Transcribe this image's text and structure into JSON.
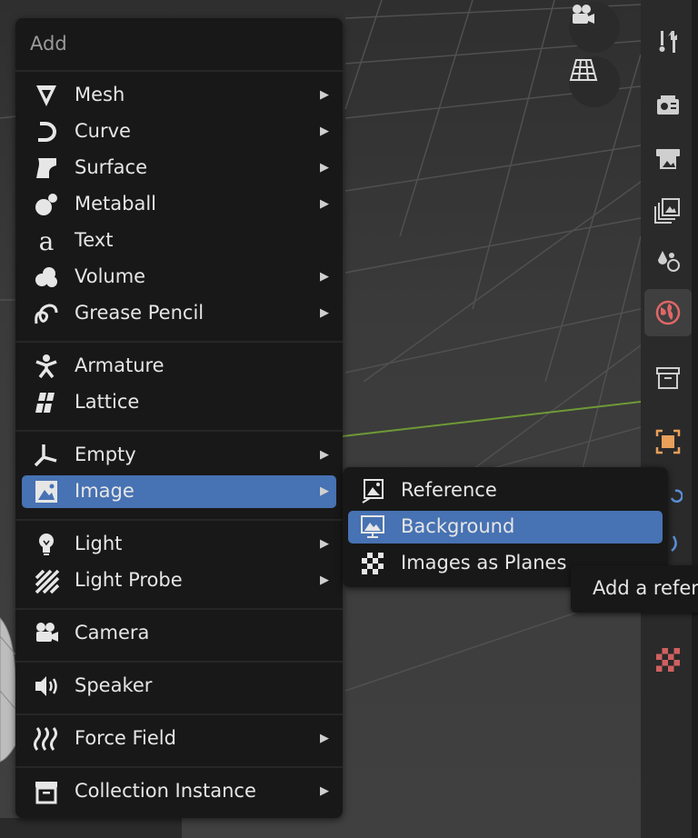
{
  "add_menu": {
    "title": "Add",
    "items": [
      {
        "label": "Mesh",
        "icon": "mesh-icon",
        "submenu": true
      },
      {
        "label": "Curve",
        "icon": "curve-icon",
        "submenu": true
      },
      {
        "label": "Surface",
        "icon": "surface-icon",
        "submenu": true
      },
      {
        "label": "Metaball",
        "icon": "metaball-icon",
        "submenu": true
      },
      {
        "label": "Text",
        "icon": "text-icon",
        "submenu": false
      },
      {
        "label": "Volume",
        "icon": "volume-icon",
        "submenu": true
      },
      {
        "label": "Grease Pencil",
        "icon": "grease-pencil-icon",
        "submenu": true
      },
      {
        "label": "Armature",
        "icon": "armature-icon",
        "submenu": false
      },
      {
        "label": "Lattice",
        "icon": "lattice-icon",
        "submenu": false
      },
      {
        "label": "Empty",
        "icon": "empty-icon",
        "submenu": true
      },
      {
        "label": "Image",
        "icon": "image-icon",
        "submenu": true,
        "highlighted": true
      },
      {
        "label": "Light",
        "icon": "light-icon",
        "submenu": true
      },
      {
        "label": "Light Probe",
        "icon": "light-probe-icon",
        "submenu": true
      },
      {
        "label": "Camera",
        "icon": "camera-icon",
        "submenu": false
      },
      {
        "label": "Speaker",
        "icon": "speaker-icon",
        "submenu": false
      },
      {
        "label": "Force Field",
        "icon": "force-field-icon",
        "submenu": true
      },
      {
        "label": "Collection Instance",
        "icon": "collection-instance-icon",
        "submenu": true
      }
    ],
    "submenu_arrow": "▶"
  },
  "image_submenu": {
    "items": [
      {
        "label": "Reference",
        "icon": "reference-image-icon"
      },
      {
        "label": "Background",
        "icon": "background-image-icon",
        "highlighted": true
      },
      {
        "label": "Images as Planes",
        "icon": "checker-texture-icon"
      }
    ]
  },
  "tooltip": {
    "text": "Add a refer"
  },
  "sidebar_tabs": [
    "tool-icon",
    "render-icon",
    "output-icon",
    "view-layer-icon",
    "scene-icon",
    "world-icon",
    "collection-icon",
    "object-icon",
    "texture-icon"
  ],
  "colors": {
    "highlight": "#4772b3",
    "menu_bg": "#181818",
    "active_world": "#e06666",
    "object_orange": "#e8a05a"
  }
}
